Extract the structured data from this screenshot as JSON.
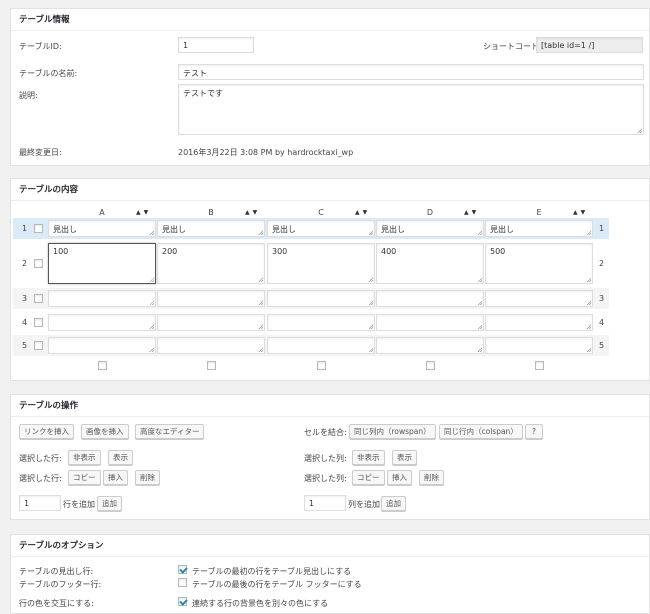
{
  "table_info": {
    "title": "テーブル情報",
    "id_label": "テーブルID:",
    "id_value": "1",
    "shortcode_label": "ショートコード:",
    "shortcode_value": "[table id=1 /]",
    "name_label": "テーブルの名前:",
    "name_value": "テスト",
    "desc_label": "説明:",
    "desc_value": "テストです",
    "modified_label": "最終変更日:",
    "modified_value": "2016年3月22日 3:08 PM by hardrocktaxi_wp"
  },
  "table_content": {
    "title": "テーブルの内容",
    "columns": [
      "A",
      "B",
      "C",
      "D",
      "E"
    ],
    "sort_arrows": "▲▼",
    "rows": [
      {
        "num": "1",
        "cells": [
          "見出し",
          "見出し",
          "見出し",
          "見出し",
          "見出し"
        ]
      },
      {
        "num": "2",
        "cells": [
          "100",
          "200",
          "300",
          "400",
          "500"
        ]
      },
      {
        "num": "3",
        "cells": [
          "",
          "",
          "",
          "",
          ""
        ]
      },
      {
        "num": "4",
        "cells": [
          "",
          "",
          "",
          "",
          ""
        ]
      },
      {
        "num": "5",
        "cells": [
          "",
          "",
          "",
          "",
          ""
        ]
      }
    ]
  },
  "table_ops": {
    "title": "テーブルの操作",
    "insert_link": "リンクを挿入",
    "insert_image": "画像を挿入",
    "advanced_editor": "高度なエディター",
    "merge_label": "セルを結合:",
    "merge_colspan_same_col": "同じ列内（rowspan）",
    "merge_rowspan_same_row": "同じ行内（colspan）",
    "help": "?",
    "selected_rows_label": "選択した行:",
    "selected_cols_label": "選択した列:",
    "hide": "非表示",
    "show": "表示",
    "copy": "コピー",
    "insert": "挿入",
    "delete": "削除",
    "add_rows_value": "1",
    "add_rows_label": "行を追加",
    "add_cols_value": "1",
    "add_cols_label": "列を追加",
    "add": "追加"
  },
  "table_options": {
    "title": "テーブルのオプション",
    "header_row_label": "テーブルの見出し行:",
    "header_row_text": "テーブルの最初の行をテーブル見出しにする",
    "footer_row_label": "テーブルのフッター行:",
    "footer_row_text": "テーブルの最後の行をテーブル フッターにする",
    "alt_colors_label": "行の色を交互にする:",
    "alt_colors_text": "連続する行の背景色を別々の色にする",
    "header_row_checked": true,
    "footer_row_checked": false,
    "alt_colors_checked": true
  },
  "colors": {
    "highlight_row": "#dbeaf7",
    "alt_row": "#f4f4f4",
    "check_blue": "#1e8cbe"
  }
}
